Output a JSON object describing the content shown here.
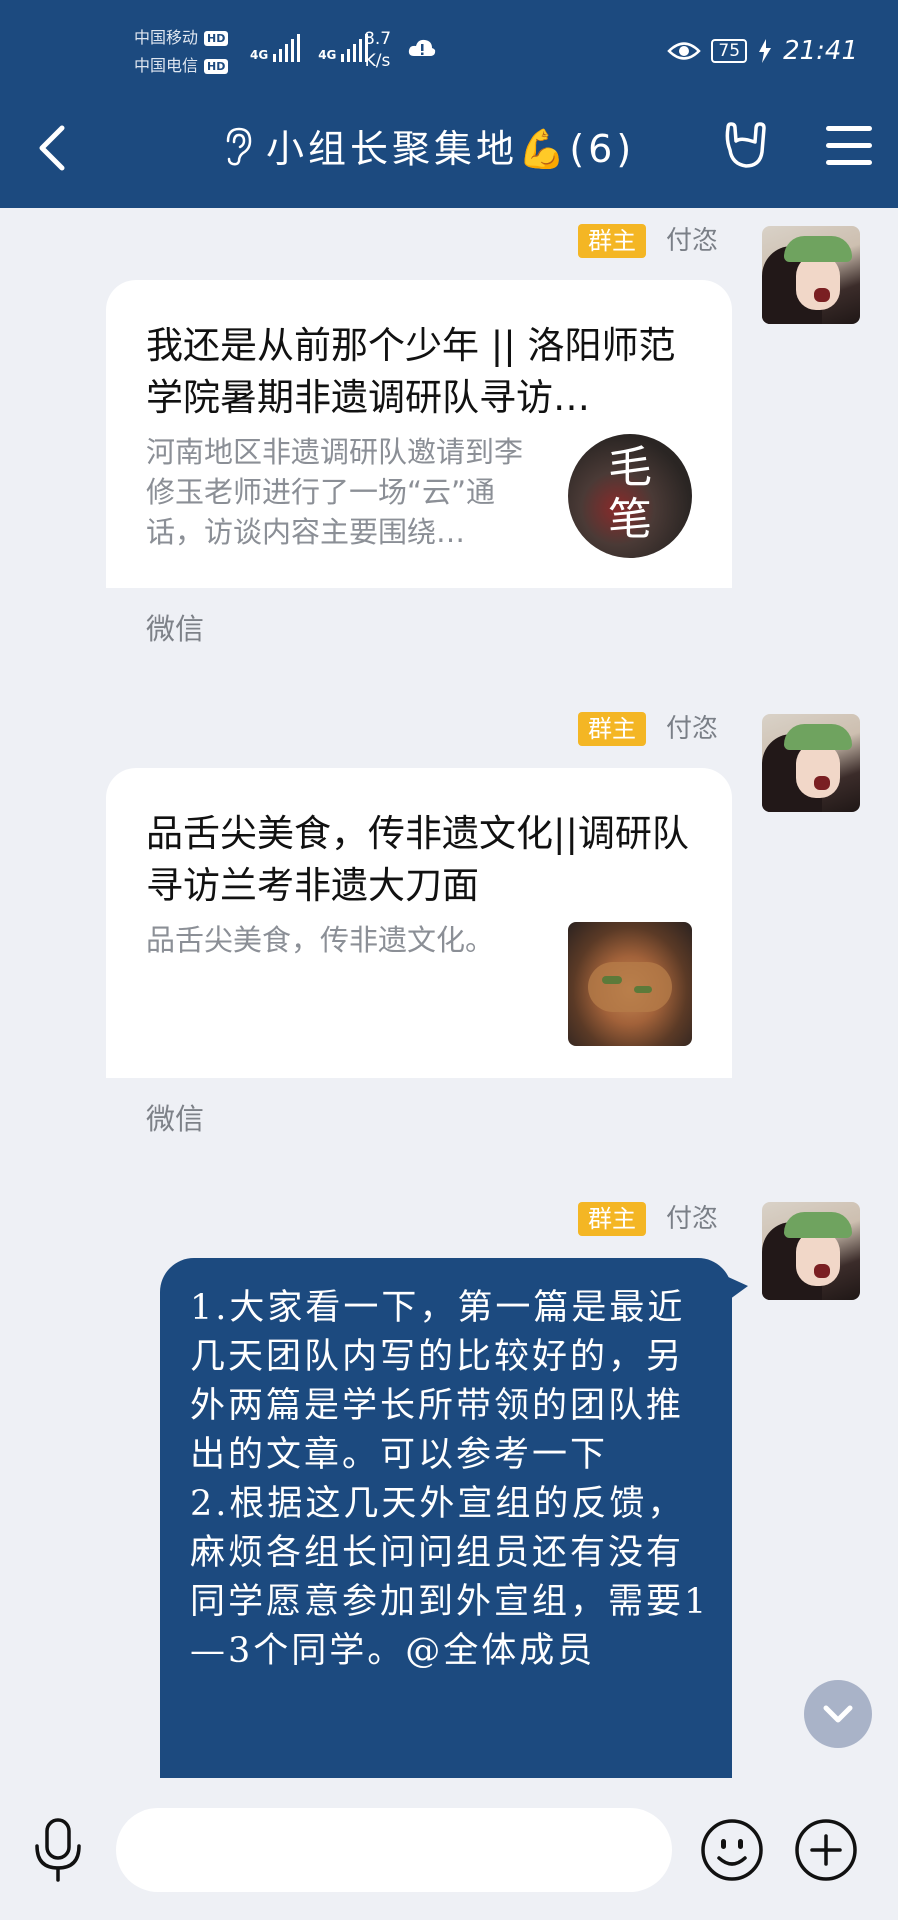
{
  "status_bar": {
    "carrier1": "中国移动",
    "carrier2": "中国电信",
    "hd": "HD",
    "net1": "4G",
    "net2": "4G",
    "speed_value": "8.7",
    "speed_unit": "K/s",
    "battery": "75",
    "time": "21:41"
  },
  "header": {
    "title": "小组长聚集地💪(6)"
  },
  "messages": [
    {
      "role_tag": "群主",
      "sender": "付恣",
      "card": {
        "title": "我还是从前那个少年 || 洛阳师范学院暑期非遗调研队寻访…",
        "description": "河南地区非遗调研队邀请到李修玉老师进行了一场“云”通话，访谈内容主要围绕…",
        "thumb_text": "毛笔",
        "source": "微信"
      }
    },
    {
      "role_tag": "群主",
      "sender": "付恣",
      "card": {
        "title": "品舌尖美食，传非遗文化||调研队寻访兰考非遗大刀面",
        "description": "品舌尖美食，传非遗文化。",
        "source": "微信"
      }
    },
    {
      "role_tag": "群主",
      "sender": "付恣",
      "text": "1.大家看一下，第一篇是最近几天团队内写的比较好的，另外两篇是学长所带领的团队推出的文章。可以参考一下\n2.根据这几天外宣组的反馈，麻烦各组长问问组员还有没有同学愿意参加到外宣组，需要1—3个同学。@全体成员"
    }
  ],
  "input_bar": {
    "placeholder": ""
  }
}
